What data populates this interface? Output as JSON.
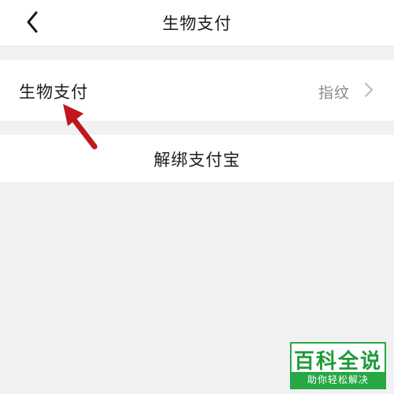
{
  "navbar": {
    "title": "生物支付",
    "back_icon": "chevron-left-icon"
  },
  "bio_payment_row": {
    "label": "生物支付",
    "value": "指纹",
    "chevron_icon": "chevron-right-icon"
  },
  "unbind_row": {
    "label": "解绑支付宝"
  },
  "annotation": {
    "arrow_icon": "red-arrow-icon",
    "color": "#c0171c"
  },
  "watermark": {
    "main": "百科全说",
    "sub": "助你轻松解决",
    "color": "#28a745"
  },
  "colors": {
    "background": "#f1f1f3",
    "surface": "#ffffff",
    "text_primary": "#1a1a1a",
    "text_secondary": "#8a8a8a"
  }
}
